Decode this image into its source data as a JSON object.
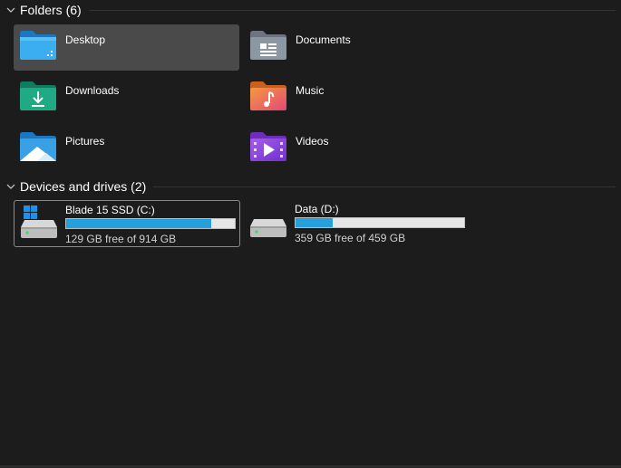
{
  "folders_section": {
    "title": "Folders (6)",
    "items": [
      {
        "label": "Desktop",
        "icon": "desktop-folder-icon",
        "selected": true
      },
      {
        "label": "Documents",
        "icon": "documents-folder-icon"
      },
      {
        "label": "Downloads",
        "icon": "downloads-folder-icon"
      },
      {
        "label": "Music",
        "icon": "music-folder-icon"
      },
      {
        "label": "Pictures",
        "icon": "pictures-folder-icon"
      },
      {
        "label": "Videos",
        "icon": "videos-folder-icon"
      }
    ]
  },
  "drives_section": {
    "title": "Devices and drives (2)",
    "drives": [
      {
        "name": "Blade 15 SSD (C:)",
        "free_text": "129 GB free of 914 GB",
        "used_fraction": 0.859,
        "icon": "windows-drive-icon",
        "focused": true
      },
      {
        "name": "Data (D:)",
        "free_text": "359 GB free of 459 GB",
        "used_fraction": 0.218,
        "icon": "hard-drive-icon"
      }
    ]
  },
  "colors": {
    "background": "#1c1c1c",
    "selected_tile": "#4a4a4a",
    "usage_bar": "#26a0da",
    "usage_bar_track": "#e6e6e6"
  }
}
